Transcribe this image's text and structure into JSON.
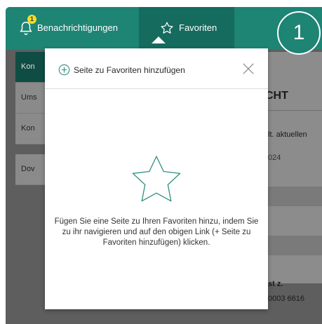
{
  "topbar": {
    "notifications_label": "Benachrichtigungen",
    "notifications_badge": "1",
    "favorites_label": "Favoriten"
  },
  "step_marker": "1",
  "background": {
    "menu_items": [
      "Kon",
      "Ums",
      "Kon",
      "Dov"
    ],
    "panel_title": "CHT",
    "panel_text1": "lt. aktuellen",
    "panel_text2": "024",
    "panel_text3": "st z.",
    "panel_text4": "0003 6616"
  },
  "popover": {
    "add_link_label": "Seite zu Favoriten hinzufügen",
    "empty_message": "Fügen Sie eine Seite zu Ihren Favoriten hinzu, indem Sie zu ihr navigieren und auf den obigen Link (+ Seite zu Favoriten hinzufügen) klicken."
  },
  "colors": {
    "brand_green": "#1e8474",
    "active_tab_green": "#146b5e",
    "badge_yellow": "#f2dd27"
  },
  "icons": {
    "bell": "bell-icon",
    "star": "star-icon",
    "plus": "plus-circle-icon",
    "close": "close-icon"
  }
}
